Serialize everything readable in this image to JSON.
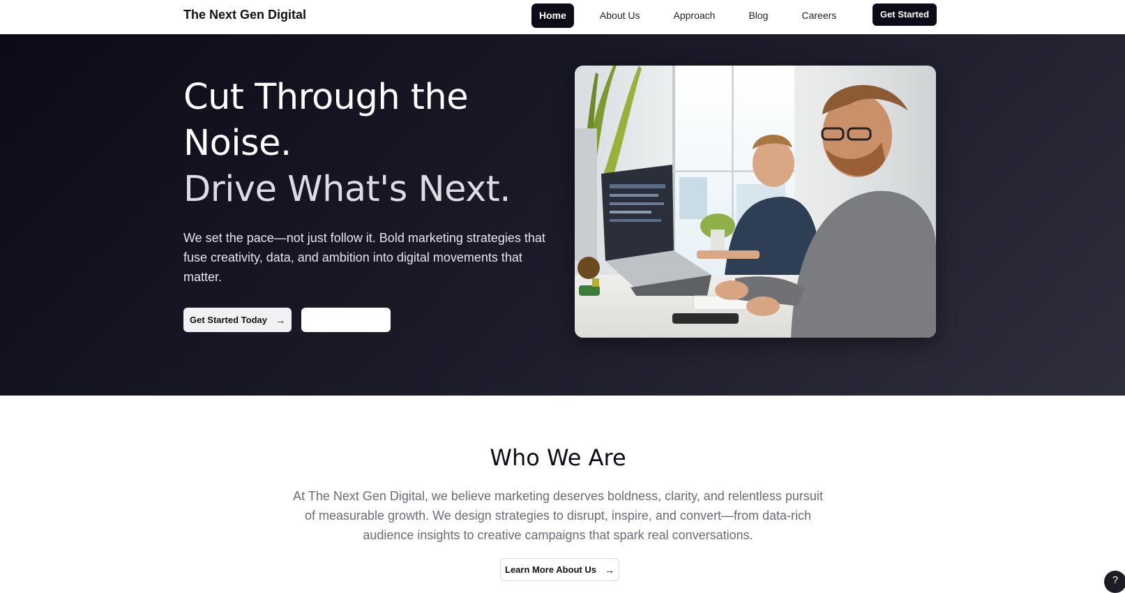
{
  "brand": "The Next Gen Digital",
  "nav": {
    "items": [
      {
        "label": "Home",
        "active": true
      },
      {
        "label": "About Us"
      },
      {
        "label": "Approach"
      },
      {
        "label": "Blog"
      },
      {
        "label": "Careers"
      }
    ],
    "cta": "Get Started"
  },
  "hero": {
    "title_line1": "Cut Through the",
    "title_line2": "Noise.",
    "title_line3": "Drive What's Next.",
    "subtitle": "We set the pace—not just follow it. Bold marketing strategies that fuse creativity, data, and ambition into digital movements that matter.",
    "primary_button": "Get Started Today",
    "secondary_button": "",
    "image_icon": "office-photo-icon"
  },
  "who": {
    "title": "Who We Are",
    "text": "At The Next Gen Digital, we believe marketing deserves boldness, clarity, and relentless pursuit of measurable growth. We design strategies to disrupt, inspire, and convert—from data-rich audience insights to creative campaigns that spark real conversations.",
    "button": "Learn More About Us"
  },
  "help_label": "?",
  "colors": {
    "dark": "#0c0b17",
    "hero_start": "#0c0b18",
    "hero_end": "#2f2e3d",
    "muted_text": "#6b6b78"
  }
}
